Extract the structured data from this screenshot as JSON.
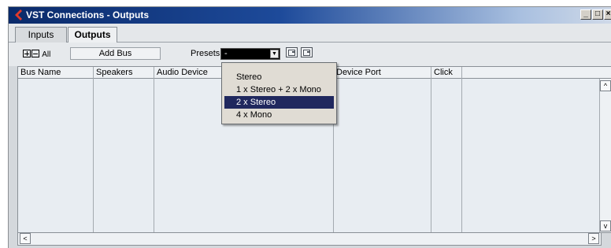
{
  "window": {
    "title": "VST Connections - Outputs",
    "controls": {
      "minimize": "_",
      "maximize": "□",
      "close": "×"
    }
  },
  "tabs": [
    {
      "label": "Inputs",
      "active": false
    },
    {
      "label": "Outputs",
      "active": true
    }
  ],
  "toolbar": {
    "expand_all_label": "All",
    "add_bus_label": "Add Bus",
    "presets_label": "Presets",
    "presets_value": "-"
  },
  "table": {
    "columns": [
      "Bus Name",
      "Speakers",
      "Audio Device",
      "Device Port",
      "Click"
    ],
    "rows": []
  },
  "presets_menu": {
    "options": [
      "Stereo",
      "1 x Stereo + 2 x Mono",
      "2 x Stereo",
      "4 x Mono"
    ],
    "selected_index": 2
  },
  "scrollbar": {
    "up": "^",
    "down": "v",
    "left": "<",
    "right": ">"
  },
  "colors": {
    "titlebar_start": "#0a2a6a",
    "selected_item": "#20285e",
    "grid_background": "#e8edf2"
  },
  "icons": [
    "app-logo-icon",
    "expand-all-icon",
    "collapse-all-icon",
    "preset-save-icon",
    "preset-remove-icon"
  ]
}
